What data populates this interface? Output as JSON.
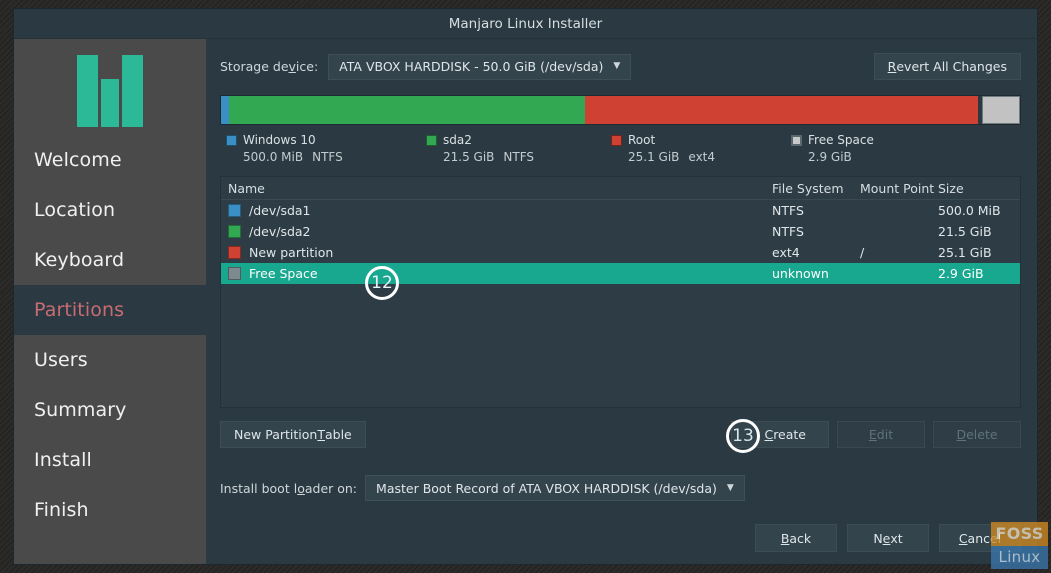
{
  "window": {
    "title": "Manjaro Linux Installer"
  },
  "sidebar": {
    "logo_color": "#2cb998",
    "items": [
      {
        "label": "Welcome",
        "active": false
      },
      {
        "label": "Location",
        "active": false
      },
      {
        "label": "Keyboard",
        "active": false
      },
      {
        "label": "Partitions",
        "active": true
      },
      {
        "label": "Users",
        "active": false
      },
      {
        "label": "Summary",
        "active": false
      },
      {
        "label": "Install",
        "active": false
      },
      {
        "label": "Finish",
        "active": false
      }
    ],
    "active_color": "#c96b72"
  },
  "toolbar": {
    "storage_label_pre": "Storage de",
    "storage_label_mn": "v",
    "storage_label_post": "ice:",
    "storage_label_full": "Storage device:",
    "storage_value": "ATA VBOX HARDDISK - 50.0 GiB (/dev/sda)",
    "caret": "▼",
    "revert_mn": "R",
    "revert_rest": "evert All Changes",
    "revert_full": "Revert All Changes"
  },
  "partition_bar": {
    "segments": [
      {
        "name": "Windows 10",
        "color": "#3a8fc4",
        "percent": 1.0
      },
      {
        "name": "sda2",
        "color": "#33a852",
        "percent": 44.5
      },
      {
        "name": "Root",
        "color": "#cf4233",
        "percent": 49.3
      },
      {
        "name": "gap",
        "color": "#2b3a42",
        "percent": 0.4
      },
      {
        "name": "Free Space",
        "color": "#c2c2c2",
        "percent": 4.8
      }
    ],
    "legend": [
      {
        "label": "Windows 10",
        "size": "500.0 MiB",
        "fs": "NTFS",
        "color": "#3a8fc4",
        "hatched": false
      },
      {
        "label": "sda2",
        "size": "21.5 GiB",
        "fs": "NTFS",
        "color": "#33a852",
        "hatched": false
      },
      {
        "label": "Root",
        "size": "25.1 GiB",
        "fs": "ext4",
        "color": "#cf4233",
        "hatched": false
      },
      {
        "label": "Free Space",
        "size": "2.9 GiB",
        "fs": "",
        "color": "#c8c8c8",
        "hatched": true
      }
    ]
  },
  "table": {
    "columns": [
      "Name",
      "File System",
      "Mount Point",
      "Size"
    ],
    "rows": [
      {
        "color": "#3a8fc4",
        "name": "/dev/sda1",
        "fs": "NTFS",
        "mount": "",
        "size": "500.0 MiB",
        "selected": false
      },
      {
        "color": "#33a852",
        "name": "/dev/sda2",
        "fs": "NTFS",
        "mount": "",
        "size": "21.5 GiB",
        "selected": false
      },
      {
        "color": "#cf4233",
        "name": "New partition",
        "fs": "ext4",
        "mount": "/",
        "size": "25.1 GiB",
        "selected": false
      },
      {
        "color": "#7d8a90",
        "name": "Free Space",
        "fs": "unknown",
        "mount": "",
        "size": "2.9 GiB",
        "selected": true
      }
    ],
    "selected_color": "#17a88f"
  },
  "actions": {
    "new_partition_table_pre": "New Partition ",
    "new_partition_table_mn": "T",
    "new_partition_table_post": "able",
    "new_partition_table_full": "New Partition Table",
    "create_mn": "C",
    "create_rest": "reate",
    "create_full": "Create",
    "edit_mn": "E",
    "edit_rest": "dit",
    "edit_full": "Edit",
    "edit_disabled": true,
    "delete_mn": "D",
    "delete_rest": "elete",
    "delete_full": "Delete",
    "delete_disabled": true
  },
  "bootloader": {
    "label_pre": "Install boot l",
    "label_mn": "o",
    "label_post": "ader on:",
    "label_full": "Install boot loader on:",
    "value": "Master Boot Record of ATA VBOX HARDDISK (/dev/sda)",
    "caret": "▼"
  },
  "footer": {
    "back_mn": "B",
    "back_rest": "ack",
    "back_full": "Back",
    "next_pre": "N",
    "next_mn": "e",
    "next_post": "xt",
    "next_full": "Next",
    "cancel_pre": "",
    "cancel_mn": "C",
    "cancel_post": "ancel",
    "cancel_full": "Cancel"
  },
  "annotations": [
    {
      "id": "12",
      "number": "12"
    },
    {
      "id": "13",
      "number": "13"
    }
  ],
  "watermark": {
    "top": "FOSS",
    "bottom": "Linux",
    "top_color": "#cf8a22",
    "bottom_color": "#3a76ab"
  }
}
